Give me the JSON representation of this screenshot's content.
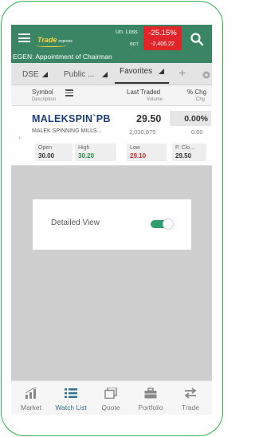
{
  "header": {
    "logo_text": "Trade",
    "logo_sub": "express",
    "unloss_label": "Un. Loss",
    "bdt_label": "BDT",
    "loss_percent": "-25.15%",
    "loss_amount": "-2,406.22",
    "ticker": "EGEN: Appointment of Chairman"
  },
  "tabs": [
    {
      "label": "DSE"
    },
    {
      "label": "Public ..."
    },
    {
      "label": "Favorites"
    }
  ],
  "columns": {
    "symbol": "Symbol",
    "description": "Description",
    "last_traded": "Last Traded",
    "volume": "Volume",
    "pct_chg": "% Chg",
    "chg": "Chg"
  },
  "stock": {
    "symbol": "MALEKSPIN`PB",
    "description": "MALEK SPINNING MILLS...",
    "last": "29.50",
    "volume": "2,030,875",
    "pct_chg": "0.00%",
    "chg": "0.00",
    "open_label": "Open",
    "open": "30.00",
    "high_label": "High",
    "high": "30.20",
    "low_label": "Low",
    "low": "29.10",
    "pclose_label": "P. Clo...",
    "pclose": "29.50"
  },
  "dialog": {
    "label": "Detailed View",
    "toggle_on": true
  },
  "nav": [
    {
      "label": "Market"
    },
    {
      "label": "Watch List"
    },
    {
      "label": "Quote"
    },
    {
      "label": "Portfolio"
    },
    {
      "label": "Trade"
    }
  ],
  "colors": {
    "header": "#3a8563",
    "loss": "#e0262b",
    "high": "#2e8b3e",
    "low": "#d92b2b",
    "symbol": "#1c3f7a",
    "active_nav": "#2f6f8f",
    "frame": "#2fb24a"
  }
}
